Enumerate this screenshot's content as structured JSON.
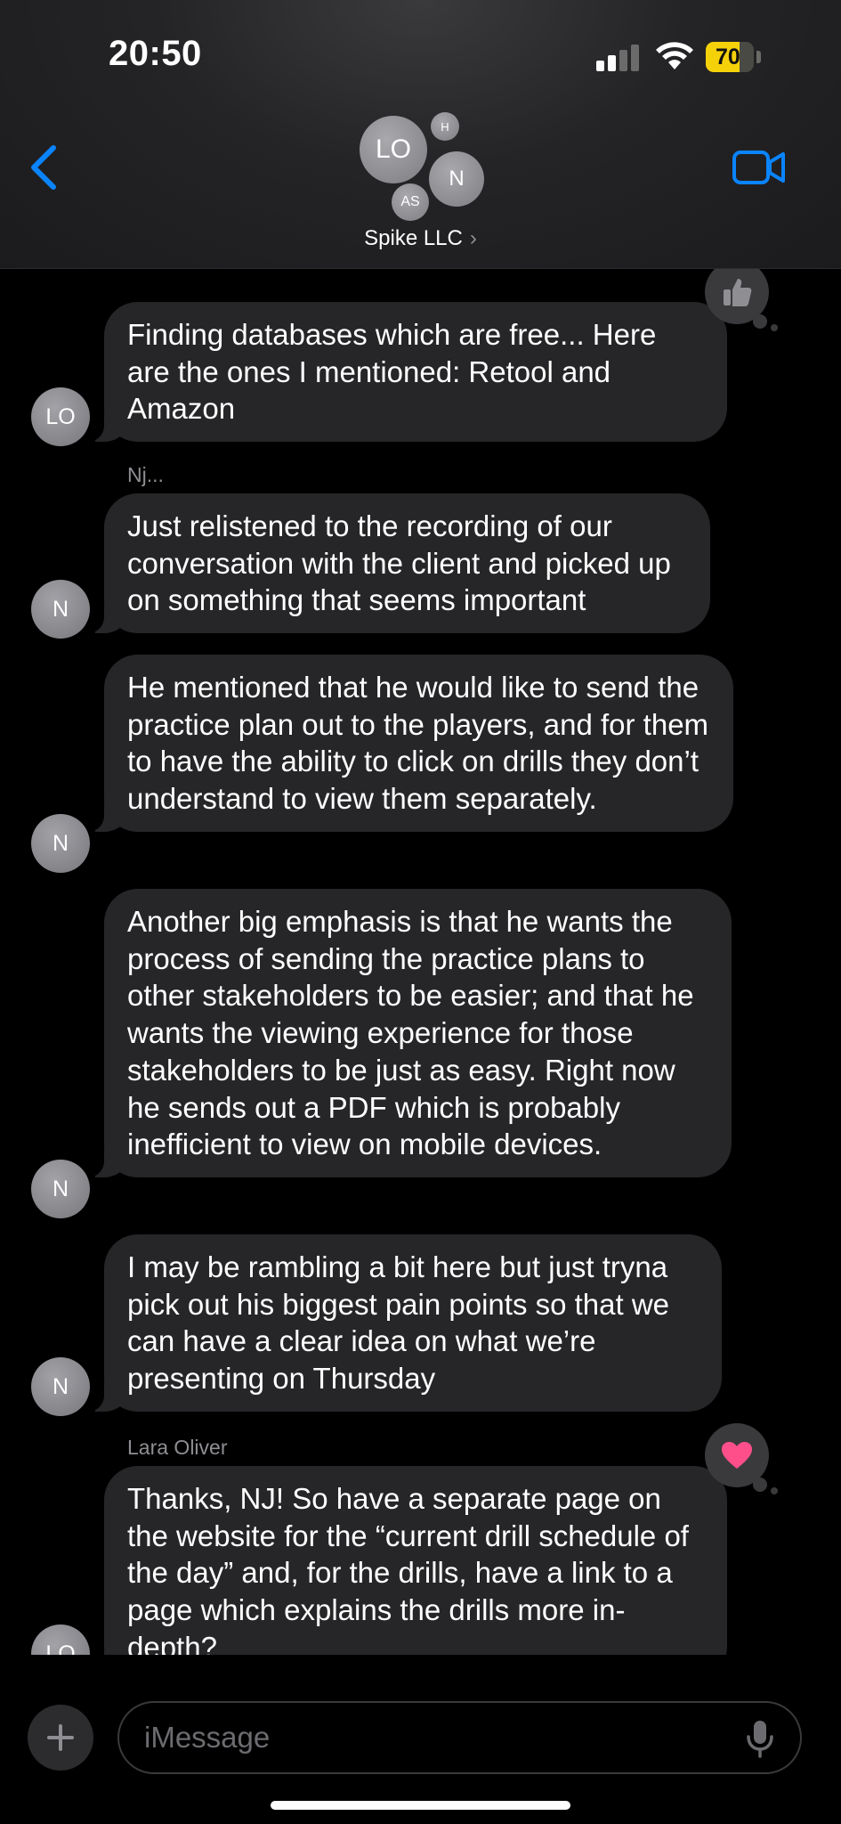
{
  "status_bar": {
    "time": "20:50",
    "battery_percent": "70",
    "signal_bars_active": 2,
    "signal_bars_total": 4
  },
  "header": {
    "group_name": "Spike LLC",
    "chevron": "›",
    "participants": [
      {
        "initials": "LO"
      },
      {
        "initials": "H"
      },
      {
        "initials": "N"
      },
      {
        "initials": "AS"
      }
    ],
    "back_icon": "chevron-left-icon",
    "video_icon": "video-camera-icon",
    "accent_color": "#0a84ff"
  },
  "messages": [
    {
      "sender_label": "",
      "avatar_initials": "LO",
      "text": "Finding databases which are free... Here are the ones I mentioned: Retool and Amazon",
      "tapback": "thumbs-up-icon"
    },
    {
      "sender_label": "Nj...",
      "avatar_initials": "N",
      "text": "Just relistened to the recording of our conversation with the client and picked up on something that seems important"
    },
    {
      "sender_label": "",
      "avatar_initials": "N",
      "text": "He mentioned that he would like to send the practice plan out to the players, and for them to have the ability to click on drills they don’t understand to view them separately."
    },
    {
      "sender_label": "",
      "avatar_initials": "N",
      "text": "Another big emphasis is that he wants the process of sending the practice plans to other stakeholders to be easier; and that he wants the viewing experience for those stakeholders to be just as easy. Right now he sends out a PDF which is probably inefficient to view on mobile devices."
    },
    {
      "sender_label": "",
      "avatar_initials": "N",
      "text": "I may be rambling a bit here but just tryna pick out his biggest pain points so that we can have a clear idea on what we’re presenting on Thursday"
    },
    {
      "sender_label": "Lara Oliver",
      "avatar_initials": "LO",
      "text": "Thanks, NJ! So have a separate page on the website for the “current drill schedule of the day” and, for the drills, have a link to a page which explains the drills more in-depth?",
      "tapback": "heart-icon"
    }
  ],
  "composer": {
    "placeholder": "iMessage",
    "plus_icon": "plus-icon",
    "mic_icon": "microphone-icon"
  },
  "colors": {
    "bubble": "#262628",
    "background": "#000000",
    "heart": "#ff4f8a",
    "battery": "#f5d10a"
  }
}
